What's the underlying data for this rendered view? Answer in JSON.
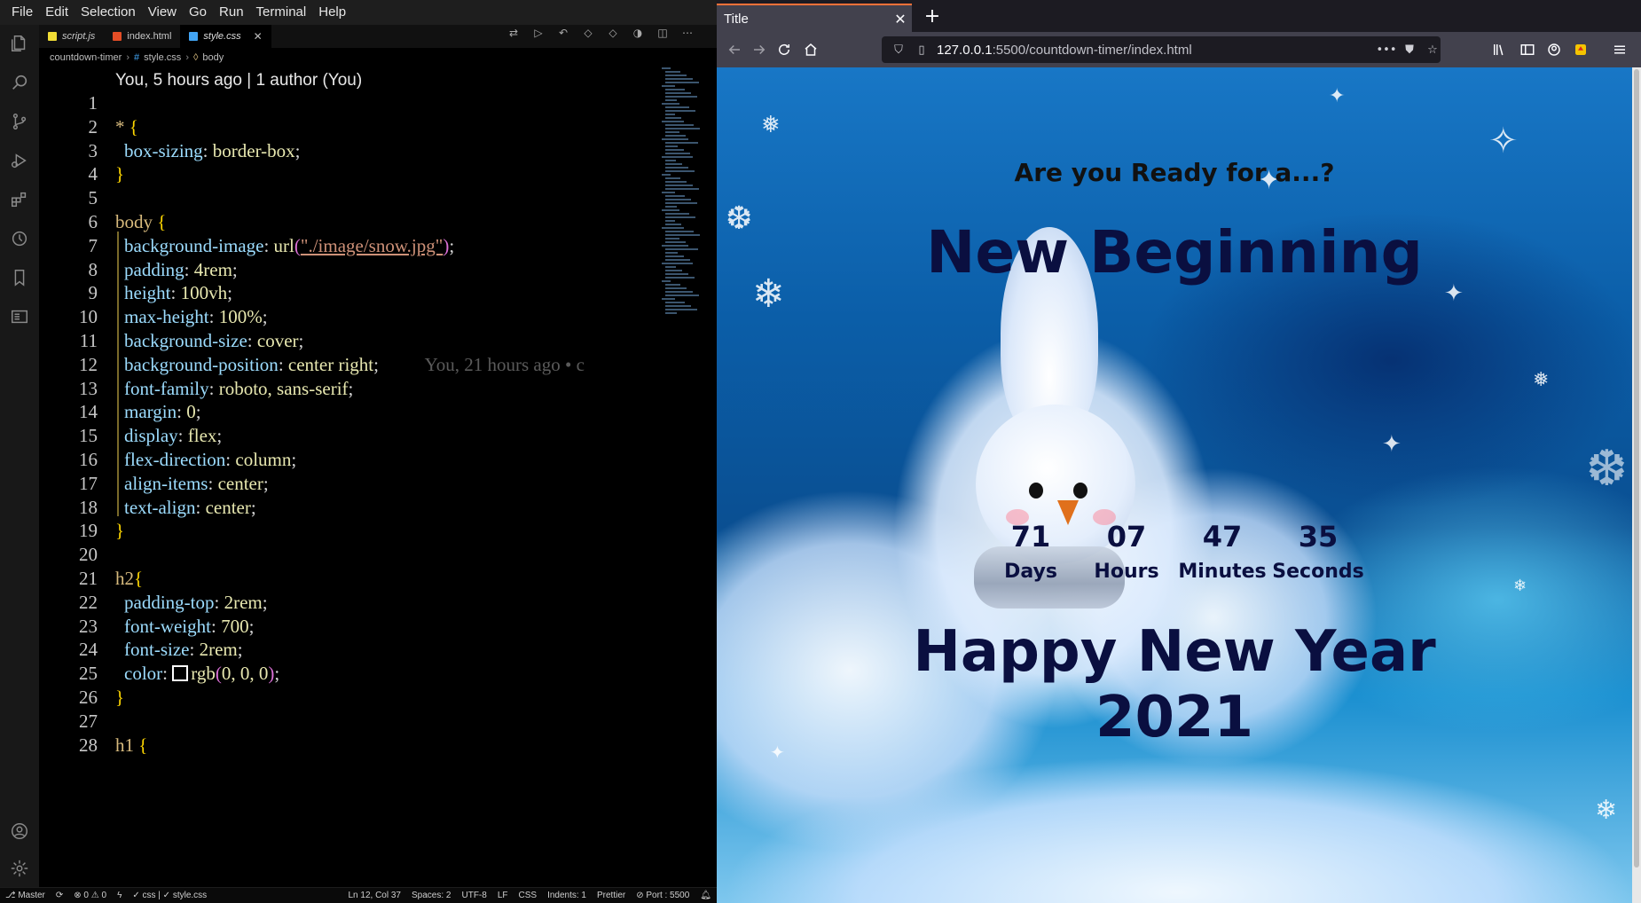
{
  "vscode": {
    "menu": [
      "File",
      "Edit",
      "Selection",
      "View",
      "Go",
      "Run",
      "Terminal",
      "Help"
    ],
    "tabs": [
      {
        "label": "script.js",
        "icon": "js-file-icon",
        "color": "#f1dd35"
      },
      {
        "label": "index.html",
        "icon": "html-file-icon",
        "color": "#e44d26"
      },
      {
        "label": "style.css",
        "icon": "css-file-icon",
        "color": "#42a5f5",
        "active": true
      }
    ],
    "breadcrumb": [
      "countdown-timer",
      "style.css",
      "body"
    ],
    "blame": "You, 5 hours ago | 1 author (You)",
    "ghost_blame": "You, 21 hours ago • c",
    "code_lines": [
      {
        "n": "1",
        "tokens": []
      },
      {
        "n": "2",
        "tokens": [
          [
            "sel",
            "* "
          ],
          [
            "brace",
            "{"
          ]
        ]
      },
      {
        "n": "3",
        "tokens": [
          [
            "prop",
            "box-sizing"
          ],
          [
            "punc",
            ": "
          ],
          [
            "val",
            "border-box"
          ],
          [
            "punc",
            ";"
          ]
        ]
      },
      {
        "n": "4",
        "tokens": [
          [
            "brace",
            "}"
          ]
        ]
      },
      {
        "n": "5",
        "tokens": []
      },
      {
        "n": "6",
        "tokens": [
          [
            "sel",
            "body "
          ],
          [
            "brace",
            "{"
          ]
        ]
      },
      {
        "n": "7",
        "tokens": [
          [
            "prop",
            "background-image"
          ],
          [
            "punc",
            ": "
          ],
          [
            "val",
            "url"
          ],
          [
            "paren",
            "("
          ],
          [
            "str",
            "\"./image/snow.jpg\""
          ],
          [
            "paren",
            ")"
          ],
          [
            "punc",
            ";"
          ]
        ]
      },
      {
        "n": "8",
        "tokens": [
          [
            "prop",
            "padding"
          ],
          [
            "punc",
            ": "
          ],
          [
            "val",
            "4rem"
          ],
          [
            "punc",
            ";"
          ]
        ]
      },
      {
        "n": "9",
        "tokens": [
          [
            "prop",
            "height"
          ],
          [
            "punc",
            ": "
          ],
          [
            "val",
            "100vh"
          ],
          [
            "punc",
            ";"
          ]
        ]
      },
      {
        "n": "10",
        "tokens": [
          [
            "prop",
            "max-height"
          ],
          [
            "punc",
            ": "
          ],
          [
            "val",
            "100%"
          ],
          [
            "punc",
            ";"
          ]
        ]
      },
      {
        "n": "11",
        "tokens": [
          [
            "prop",
            "background-size"
          ],
          [
            "punc",
            ": "
          ],
          [
            "val",
            "cover"
          ],
          [
            "punc",
            ";"
          ]
        ]
      },
      {
        "n": "12",
        "tokens": [
          [
            "prop",
            "background-position"
          ],
          [
            "punc",
            ": "
          ],
          [
            "val",
            "center right"
          ],
          [
            "punc",
            ";"
          ]
        ]
      },
      {
        "n": "13",
        "tokens": [
          [
            "prop",
            "font-family"
          ],
          [
            "punc",
            ": "
          ],
          [
            "val",
            "roboto, sans-serif"
          ],
          [
            "punc",
            ";"
          ]
        ]
      },
      {
        "n": "14",
        "tokens": [
          [
            "prop",
            "margin"
          ],
          [
            "punc",
            ": "
          ],
          [
            "val",
            "0"
          ],
          [
            "punc",
            ";"
          ]
        ]
      },
      {
        "n": "15",
        "tokens": [
          [
            "prop",
            "display"
          ],
          [
            "punc",
            ": "
          ],
          [
            "val",
            "flex"
          ],
          [
            "punc",
            ";"
          ]
        ]
      },
      {
        "n": "16",
        "tokens": [
          [
            "prop",
            "flex-direction"
          ],
          [
            "punc",
            ": "
          ],
          [
            "val",
            "column"
          ],
          [
            "punc",
            ";"
          ]
        ]
      },
      {
        "n": "17",
        "tokens": [
          [
            "prop",
            "align-items"
          ],
          [
            "punc",
            ": "
          ],
          [
            "val",
            "center"
          ],
          [
            "punc",
            ";"
          ]
        ]
      },
      {
        "n": "18",
        "tokens": [
          [
            "prop",
            "text-align"
          ],
          [
            "punc",
            ": "
          ],
          [
            "val",
            "center"
          ],
          [
            "punc",
            ";"
          ]
        ]
      },
      {
        "n": "19",
        "tokens": [
          [
            "brace",
            "}"
          ]
        ]
      },
      {
        "n": "20",
        "tokens": []
      },
      {
        "n": "21",
        "tokens": [
          [
            "sel",
            "h2"
          ],
          [
            "brace",
            "{"
          ]
        ]
      },
      {
        "n": "22",
        "tokens": [
          [
            "prop",
            "padding-top"
          ],
          [
            "punc",
            ": "
          ],
          [
            "val",
            "2rem"
          ],
          [
            "punc",
            ";"
          ]
        ]
      },
      {
        "n": "23",
        "tokens": [
          [
            "prop",
            "font-weight"
          ],
          [
            "punc",
            ": "
          ],
          [
            "val",
            "700"
          ],
          [
            "punc",
            ";"
          ]
        ]
      },
      {
        "n": "24",
        "tokens": [
          [
            "prop",
            "font-size"
          ],
          [
            "punc",
            ": "
          ],
          [
            "val",
            "2rem"
          ],
          [
            "punc",
            ";"
          ]
        ]
      },
      {
        "n": "25",
        "tokens": [
          [
            "prop",
            "color"
          ],
          [
            "punc",
            ": "
          ],
          [
            "swatch",
            ""
          ],
          [
            "val",
            "rgb"
          ],
          [
            "paren",
            "("
          ],
          [
            "val",
            "0, 0, 0"
          ],
          [
            "paren",
            ")"
          ],
          [
            "punc",
            ";"
          ]
        ]
      },
      {
        "n": "26",
        "tokens": [
          [
            "brace",
            "}"
          ]
        ]
      },
      {
        "n": "27",
        "tokens": []
      },
      {
        "n": "28",
        "tokens": [
          [
            "sel",
            "h1 "
          ],
          [
            "brace",
            "{"
          ]
        ]
      }
    ],
    "status": {
      "branch": "Master",
      "problems": "⊗ 0 ⚠ 0",
      "language_check": "✓ css | ✓ style.css",
      "position": "Ln 12, Col 37",
      "spaces": "Spaces: 2",
      "encoding": "UTF-8",
      "eol": "LF",
      "language": "CSS",
      "indents": "Indents: 1",
      "formatter": "Prettier",
      "port": "⊘ Port : 5500"
    }
  },
  "firefox": {
    "tab_title": "Title",
    "url_host": "127.0.0.1",
    "url_rest": ":5500/countdown-timer/index.html",
    "page": {
      "tagline": "Are you Ready for a...?",
      "headline": "New Beginning",
      "countdown": [
        {
          "value": "71",
          "label": "Days"
        },
        {
          "value": "07",
          "label": "Hours"
        },
        {
          "value": "47",
          "label": "Minutes"
        },
        {
          "value": "35",
          "label": "Seconds"
        }
      ],
      "happy_line1": "Happy New Year",
      "happy_line2": "2021"
    }
  }
}
